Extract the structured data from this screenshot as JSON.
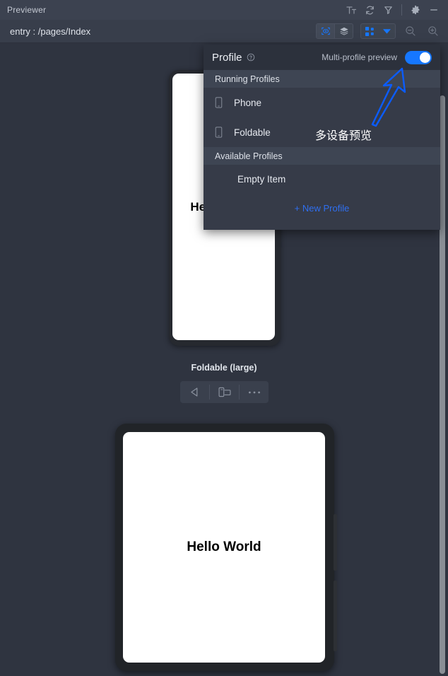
{
  "window": {
    "title": "Previewer",
    "titlebar_icons": [
      {
        "name": "font-size-icon",
        "glyph": "Tт"
      },
      {
        "name": "refresh-icon",
        "glyph": "⟳"
      },
      {
        "name": "plug-icon",
        "glyph": "⚟"
      },
      {
        "name": "settings-gear-icon",
        "glyph": "⚙"
      },
      {
        "name": "minimize-icon",
        "glyph": "—"
      }
    ]
  },
  "toolbar": {
    "entry_label": "entry : /pages/Index",
    "inspector_icon": "inspector-icon",
    "layers_icon": "layers-icon",
    "profile_grid_icon": "profile-grid-icon",
    "dropdown_caret": "▼",
    "zoom_out_icon": "zoom-out-icon",
    "zoom_in_icon": "zoom-in-icon",
    "accent_color": "#1677ff"
  },
  "profile_panel": {
    "title": "Profile",
    "help_icon": "help-circle-icon",
    "toggle_label": "Multi-profile preview",
    "toggle_on": true,
    "toggle_color": "#1677ff",
    "sections": [
      {
        "heading": "Running Profiles",
        "items": [
          {
            "label": "Phone",
            "icon": "phone-device-icon"
          },
          {
            "label": "Foldable",
            "icon": "foldable-device-icon"
          }
        ]
      },
      {
        "heading": "Available Profiles",
        "items": [
          {
            "label": "Empty Item",
            "icon": ""
          }
        ]
      }
    ],
    "new_profile_label": "+ New Profile",
    "new_profile_color": "#2f6ff0"
  },
  "previews": [
    {
      "name": "phone-preview",
      "screen_text": "Hello World",
      "caption": ""
    },
    {
      "name": "foldable-preview",
      "screen_text": "Hello World",
      "caption": "Foldable (large)",
      "controls": [
        {
          "name": "rotate-back-button",
          "glyph": "◁"
        },
        {
          "name": "fold-unfold-button",
          "glyph": "fold"
        },
        {
          "name": "more-options-button",
          "glyph": "•••"
        }
      ]
    }
  ],
  "annotation": {
    "text": "多设备预览",
    "arrow_color": "#0b5cff",
    "arrow_name": "annotation-arrow"
  },
  "scrollbar": {
    "name": "vertical-scrollbar",
    "color": "#8a8f96"
  }
}
